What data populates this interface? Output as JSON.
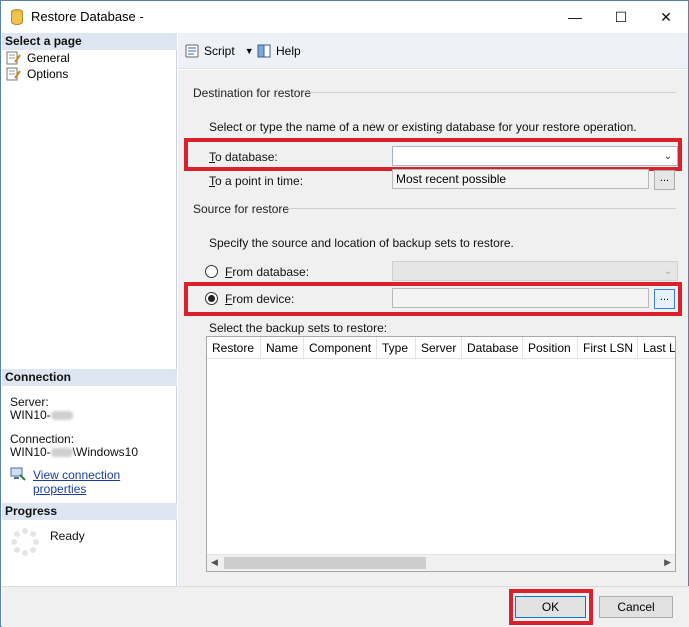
{
  "window": {
    "title": "Restore Database -",
    "controls": {
      "minimize": "—",
      "maximize": "☐",
      "close": "✕"
    }
  },
  "left": {
    "select_page_header": "Select a page",
    "pages": [
      {
        "label": "General",
        "icon": "page-wrench-icon"
      },
      {
        "label": "Options",
        "icon": "page-wrench-icon"
      }
    ],
    "connection_header": "Connection",
    "server_label": "Server:",
    "server_value": "WIN10-",
    "connection_label": "Connection:",
    "connection_value_prefix": "WIN10-",
    "connection_value_suffix": "\\Windows10",
    "view_connection_link": "View connection properties",
    "progress_header": "Progress",
    "progress_status": "Ready"
  },
  "toolbar": {
    "script_label": "Script",
    "help_label": "Help"
  },
  "destination": {
    "group_title": "Destination for restore",
    "instruction": "Select or type the name of a new or existing database for your restore operation.",
    "to_database_label_u": "T",
    "to_database_label_rest": "o database:",
    "to_database_value": "",
    "point_in_time_label_u": "T",
    "point_in_time_label_rest": "o a point in time:",
    "point_in_time_value": "Most recent possible",
    "ellipsis": "..."
  },
  "source": {
    "group_title": "Source for restore",
    "instruction": "Specify the source and location of backup sets to restore.",
    "from_database_label_u": "F",
    "from_database_label_rest": "rom database:",
    "from_device_label_u": "F",
    "from_device_label_rest": "rom device:",
    "from_device_value": "",
    "selected_option": "from_device",
    "ellipsis": "..."
  },
  "backup_sets": {
    "label": "Select the backup sets to restore:",
    "columns": [
      "Restore",
      "Name",
      "Component",
      "Type",
      "Server",
      "Database",
      "Position",
      "First LSN",
      "Last LS"
    ]
  },
  "footer": {
    "ok_label": "OK",
    "cancel_label": "Cancel"
  },
  "colors": {
    "highlight": "#d9212e",
    "section_header_bg": "#dde6f1",
    "link": "#1a3f9c"
  }
}
